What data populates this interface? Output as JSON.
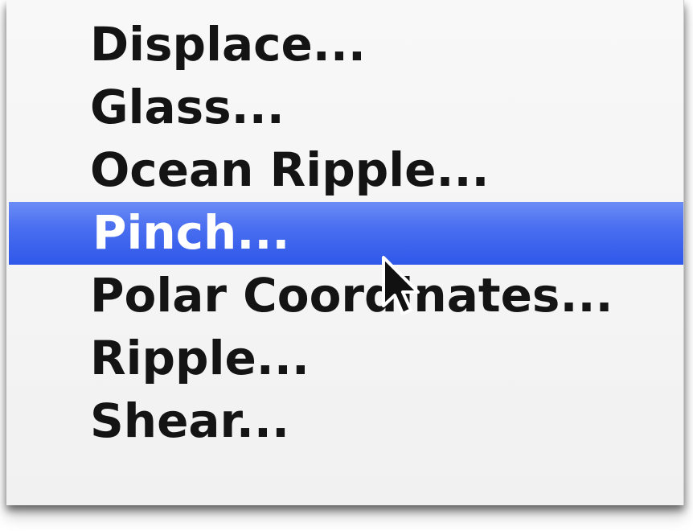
{
  "menu": {
    "items": [
      {
        "label": "Displace..."
      },
      {
        "label": "Glass..."
      },
      {
        "label": "Ocean Ripple..."
      },
      {
        "label": "Pinch..."
      },
      {
        "label": "Polar Coordinates..."
      },
      {
        "label": "Ripple..."
      },
      {
        "label": "Shear..."
      }
    ],
    "selected_item": "Pinch..."
  },
  "icons": {
    "cursor": "arrow-cursor-icon"
  },
  "colors": {
    "highlight": "#3e63ee",
    "menu_background": "#f5f5f5",
    "text": "#141414",
    "selected_text": "#ffffff"
  }
}
